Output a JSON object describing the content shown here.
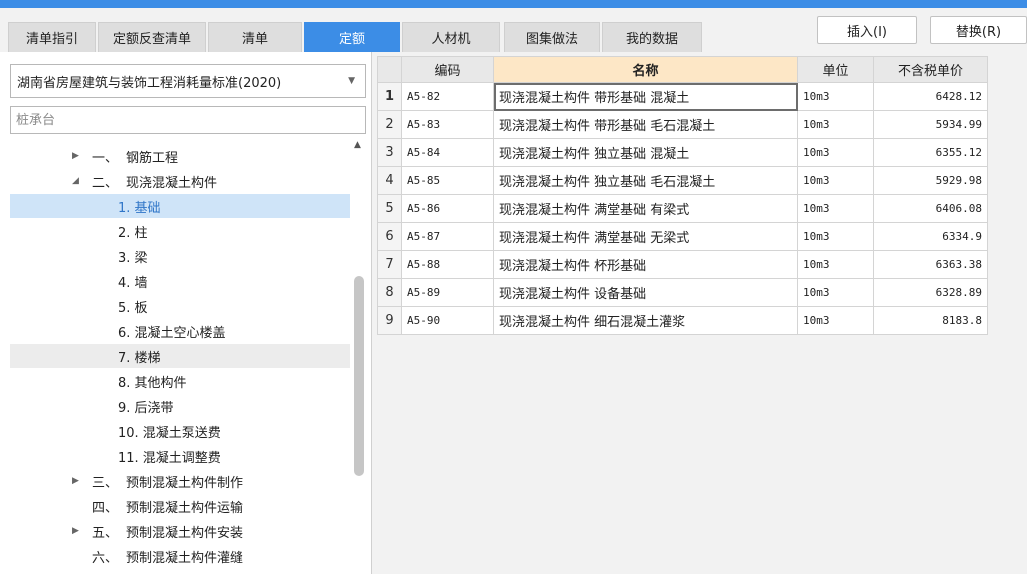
{
  "tabs": [
    {
      "label": "清单指引",
      "active": false
    },
    {
      "label": "定额反查清单",
      "active": false
    },
    {
      "label": "清单",
      "active": false
    },
    {
      "label": "定额",
      "active": true
    },
    {
      "label": "人材机",
      "active": false
    },
    {
      "label": "图集做法",
      "active": false
    },
    {
      "label": "我的数据",
      "active": false
    }
  ],
  "toolbar": {
    "insert_label": "插入(I)",
    "replace_label": "替换(R)"
  },
  "standard_select": {
    "value": "湖南省房屋建筑与装饰工程消耗量标准(2020)"
  },
  "search": {
    "placeholder": "桩承台"
  },
  "tree": [
    {
      "num": "一、",
      "label": "钢筋工程",
      "level": 0,
      "arrow": "right"
    },
    {
      "num": "二、",
      "label": "现浇混凝土构件",
      "level": 0,
      "arrow": "down"
    },
    {
      "label": "1. 基础",
      "level": 1,
      "state": "selected"
    },
    {
      "label": "2. 柱",
      "level": 1
    },
    {
      "label": "3. 梁",
      "level": 1
    },
    {
      "label": "4. 墙",
      "level": 1
    },
    {
      "label": "5. 板",
      "level": 1
    },
    {
      "label": "6. 混凝土空心楼盖",
      "level": 1
    },
    {
      "label": "7. 楼梯",
      "level": 1,
      "state": "hover"
    },
    {
      "label": "8. 其他构件",
      "level": 1
    },
    {
      "label": "9. 后浇带",
      "level": 1
    },
    {
      "label": "10. 混凝土泵送费",
      "level": 1
    },
    {
      "label": "11. 混凝土调整费",
      "level": 1
    },
    {
      "num": "三、",
      "label": "预制混凝土构件制作",
      "level": 0,
      "arrow": "right"
    },
    {
      "num": "四、",
      "label": "预制混凝土构件运输",
      "level": 0
    },
    {
      "num": "五、",
      "label": "预制混凝土构件安装",
      "level": 0,
      "arrow": "right"
    },
    {
      "num": "六、",
      "label": "预制混凝土构件灌缝",
      "level": 0
    }
  ],
  "table": {
    "columns": [
      "编码",
      "名称",
      "单位",
      "不含税单价"
    ],
    "rows": [
      {
        "index": "1",
        "code": "A5-82",
        "name": "现浇混凝土构件 带形基础 混凝土",
        "unit": "10m3",
        "price": "6428.12"
      },
      {
        "index": "2",
        "code": "A5-83",
        "name": "现浇混凝土构件 带形基础 毛石混凝土",
        "unit": "10m3",
        "price": "5934.99"
      },
      {
        "index": "3",
        "code": "A5-84",
        "name": "现浇混凝土构件 独立基础 混凝土",
        "unit": "10m3",
        "price": "6355.12"
      },
      {
        "index": "4",
        "code": "A5-85",
        "name": "现浇混凝土构件 独立基础 毛石混凝土",
        "unit": "10m3",
        "price": "5929.98"
      },
      {
        "index": "5",
        "code": "A5-86",
        "name": "现浇混凝土构件 满堂基础 有梁式",
        "unit": "10m3",
        "price": "6406.08"
      },
      {
        "index": "6",
        "code": "A5-87",
        "name": "现浇混凝土构件 满堂基础 无梁式",
        "unit": "10m3",
        "price": "6334.9"
      },
      {
        "index": "7",
        "code": "A5-88",
        "name": "现浇混凝土构件 杯形基础",
        "unit": "10m3",
        "price": "6363.38"
      },
      {
        "index": "8",
        "code": "A5-89",
        "name": "现浇混凝土构件 设备基础",
        "unit": "10m3",
        "price": "6328.89"
      },
      {
        "index": "9",
        "code": "A5-90",
        "name": "现浇混凝土构件 细石混凝土灌浆",
        "unit": "10m3",
        "price": "8183.8"
      }
    ]
  },
  "colors": {
    "accent": "#3c8de6",
    "selected_row": "#cfe4f8",
    "name_header": "#fde7c6"
  }
}
